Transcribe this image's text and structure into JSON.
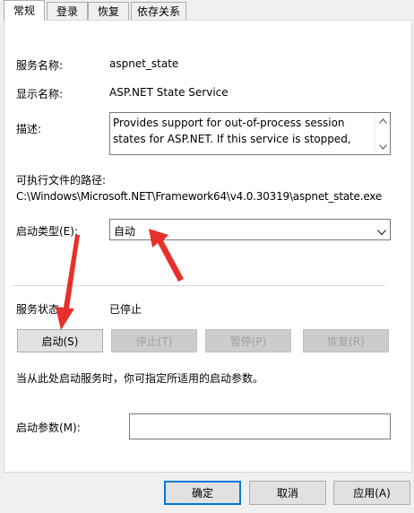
{
  "tabs": [
    {
      "label": "常规",
      "active": true
    },
    {
      "label": "登录",
      "active": false
    },
    {
      "label": "恢复",
      "active": false
    },
    {
      "label": "依存关系",
      "active": false
    }
  ],
  "fields": {
    "service_name_label": "服务名称:",
    "service_name_value": "aspnet_state",
    "display_name_label": "显示名称:",
    "display_name_value": "ASP.NET State Service",
    "description_label": "描述:",
    "description_value": "Provides support for out-of-process session states for ASP.NET. If this service is stopped,",
    "exe_path_label": "可执行文件的路径:",
    "exe_path_value": "C:\\Windows\\Microsoft.NET\\Framework64\\v4.0.30319\\aspnet_state.exe",
    "startup_type_label": "启动类型(E):",
    "startup_type_value": "自动",
    "status_label": "服务状态:",
    "status_value": "已停止",
    "hint_text": "当从此处启动服务时，你可指定所适用的启动参数。",
    "params_label": "启动参数(M):",
    "params_value": ""
  },
  "service_buttons": {
    "start": "启动(S)",
    "stop": "停止(T)",
    "pause": "暂停(P)",
    "resume": "恢复(R)"
  },
  "dialog_buttons": {
    "ok": "确定",
    "cancel": "取消",
    "apply": "应用(A)"
  },
  "colors": {
    "annotation_arrow": "#e8302a",
    "accent_border": "#0078d7"
  }
}
